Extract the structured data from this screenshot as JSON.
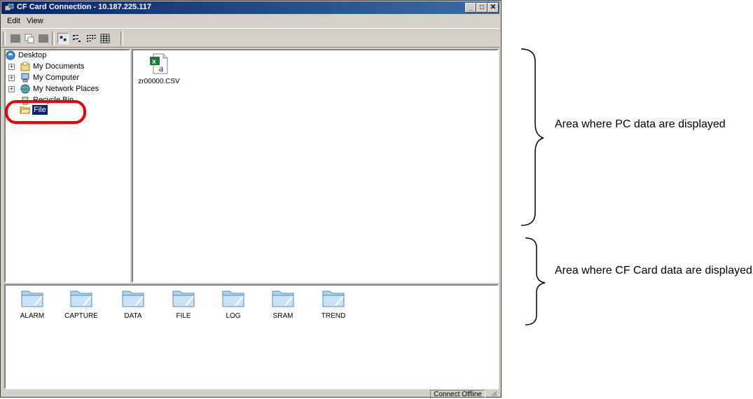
{
  "window": {
    "title": "CF Card Connection - 10.187.225.117",
    "controls": {
      "minimize": "_",
      "maximize": "□",
      "close": "✕"
    }
  },
  "menu": [
    {
      "label": "Edit"
    },
    {
      "label": "View"
    }
  ],
  "tree": {
    "root": "Desktop",
    "items": [
      {
        "label": "My Documents",
        "icon": "my-documents-icon"
      },
      {
        "label": "My Computer",
        "icon": "my-computer-icon"
      },
      {
        "label": "My Network Places",
        "icon": "network-places-icon"
      },
      {
        "label": "Recycle Bin",
        "icon": "recycle-bin-icon"
      },
      {
        "label": "File",
        "icon": "folder-open-icon",
        "selected": true
      }
    ]
  },
  "pc_files": [
    {
      "name": "zr00000.CSV",
      "icon": "excel-csv-icon"
    }
  ],
  "cf_folders": [
    {
      "name": "ALARM"
    },
    {
      "name": "CAPTURE"
    },
    {
      "name": "DATA"
    },
    {
      "name": "FILE"
    },
    {
      "name": "LOG"
    },
    {
      "name": "SRAM"
    },
    {
      "name": "TREND"
    }
  ],
  "status": "Connect Offline",
  "annotations": {
    "pc_area": "Area where PC data are displayed",
    "cf_area": "Area where CF Card data are displayed"
  },
  "colors": {
    "title_gradient_start": "#0a246a",
    "title_gradient_end": "#3a6ea5",
    "highlight_circle": "#e8000b",
    "selection": "#0a246a",
    "window_face": "#d4d0c8"
  }
}
